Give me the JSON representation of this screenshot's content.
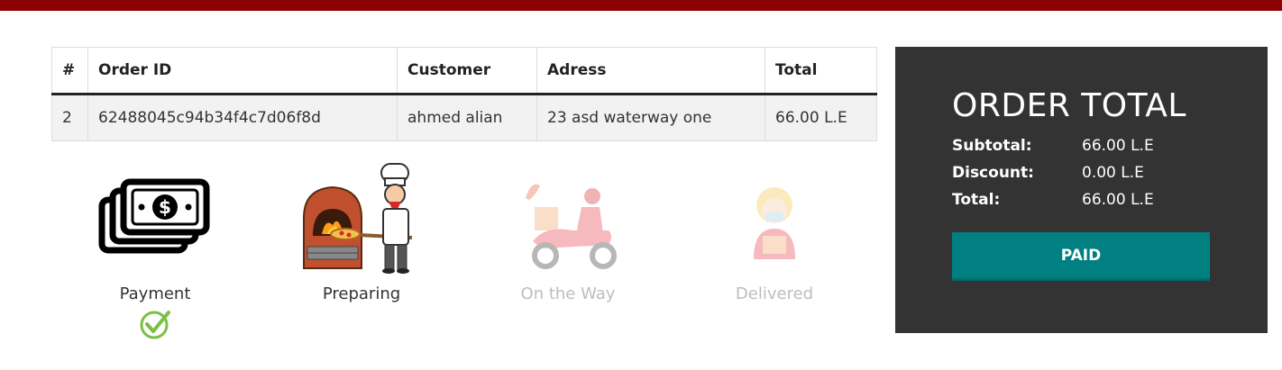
{
  "orders_table": {
    "headers": [
      "#",
      "Order ID",
      "Customer",
      "Adress",
      "Total"
    ],
    "rows": [
      [
        "2",
        "62488045c94b34f4c7d06f8d",
        "ahmed alian",
        "23 asd waterway one",
        "66.00 L.E"
      ]
    ]
  },
  "steps": [
    {
      "label": "Payment",
      "icon": "cash-icon",
      "state": "done"
    },
    {
      "label": "Preparing",
      "icon": "chef-oven-icon",
      "state": "active"
    },
    {
      "label": "On the Way",
      "icon": "delivery-scooter-icon",
      "state": "inactive"
    },
    {
      "label": "Delivered",
      "icon": "delivery-person-icon",
      "state": "inactive"
    }
  ],
  "summary": {
    "title": "ORDER TOTAL",
    "subtotal_label": "Subtotal:",
    "subtotal_value": "66.00 L.E",
    "discount_label": "Discount:",
    "discount_value": "0.00 L.E",
    "total_label": "Total:",
    "total_value": "66.00 L.E",
    "button_label": "PAID"
  },
  "colors": {
    "top_bar": "#8b0000",
    "panel_bg": "#333333",
    "paid_button": "#008080",
    "check": "#7bc043"
  }
}
